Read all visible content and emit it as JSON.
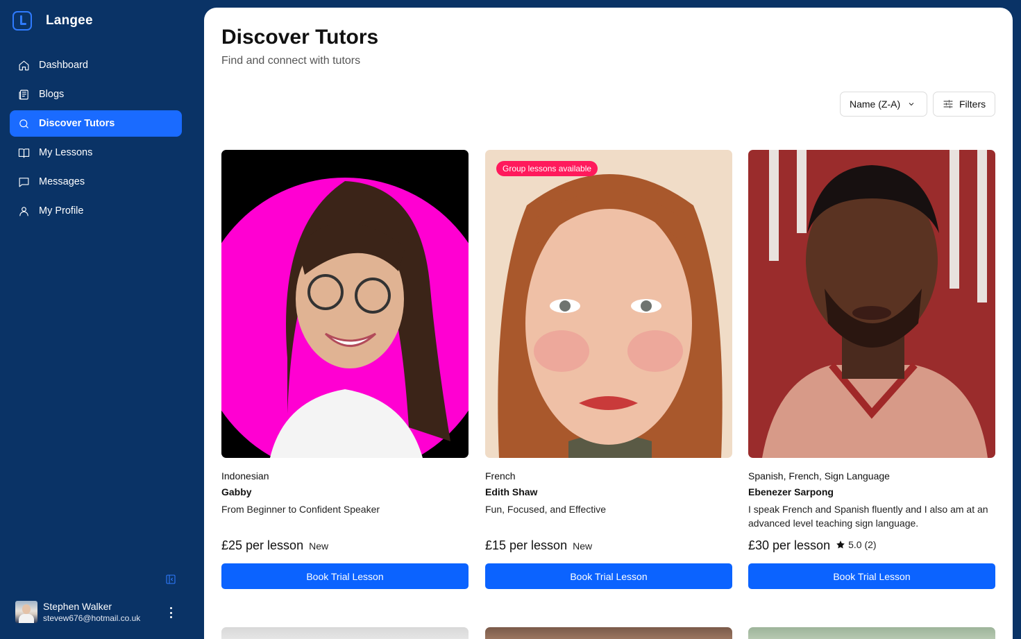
{
  "brand": {
    "name": "Langee",
    "logo_icon": "langee-logo-icon"
  },
  "sidebar": {
    "items": [
      {
        "label": "Dashboard",
        "icon": "home-icon",
        "active": false
      },
      {
        "label": "Blogs",
        "icon": "newspaper-icon",
        "active": false
      },
      {
        "label": "Discover Tutors",
        "icon": "search-icon",
        "active": true
      },
      {
        "label": "My Lessons",
        "icon": "book-open-icon",
        "active": false
      },
      {
        "label": "Messages",
        "icon": "message-square-icon",
        "active": false
      },
      {
        "label": "My Profile",
        "icon": "user-icon",
        "active": false
      }
    ]
  },
  "user": {
    "name": "Stephen Walker",
    "email": "stevew676@hotmail.co.uk"
  },
  "page": {
    "title": "Discover Tutors",
    "subtitle": "Find and connect with tutors"
  },
  "toolbar": {
    "sort_value": "Name (Z-A)",
    "filters_label": "Filters"
  },
  "tutors": [
    {
      "languages": "Indonesian",
      "name": "Gabby",
      "headline": "From Beginner to Confident Speaker",
      "price": "£25 per lesson",
      "tag": "New",
      "badge": "",
      "button": "Book Trial Lesson"
    },
    {
      "languages": "French",
      "name": "Edith Shaw",
      "headline": "Fun, Focused, and Effective",
      "price": "£15 per lesson",
      "tag": "New",
      "badge": "Group lessons available",
      "button": "Book Trial Lesson"
    },
    {
      "languages": "Spanish, French, Sign Language",
      "name": "Ebenezer Sarpong",
      "headline": "I speak French and Spanish fluently and I also am at an advanced level teaching sign language.",
      "price": "£30 per lesson",
      "rating": "5.0 (2)",
      "badge": "",
      "button": "Book Trial Lesson"
    }
  ],
  "colors": {
    "sidebar_bg": "#0a3366",
    "accent": "#0b63ff",
    "active_nav": "#1a6bff",
    "badge": "#ff1a5c"
  }
}
